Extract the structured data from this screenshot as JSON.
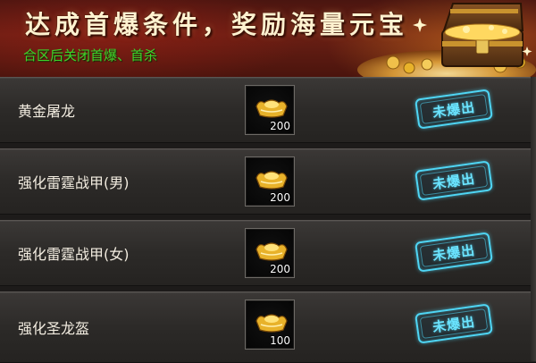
{
  "banner": {
    "title": "达成首爆条件，奖励海量元宝",
    "subtitle": "合区后关闭首爆、首杀"
  },
  "colors": {
    "title": "#fff2d0",
    "subtitle": "#3fd52a",
    "stamp": "#4fd6f5",
    "ingot": "#e8b22a"
  },
  "items": [
    {
      "name": "黄金屠龙",
      "reward_icon": "gold-ingot-icon",
      "reward_amount": "200",
      "status": "未爆出"
    },
    {
      "name": "强化雷霆战甲(男)",
      "reward_icon": "gold-ingot-icon",
      "reward_amount": "200",
      "status": "未爆出"
    },
    {
      "name": "强化雷霆战甲(女)",
      "reward_icon": "gold-ingot-icon",
      "reward_amount": "200",
      "status": "未爆出"
    },
    {
      "name": "强化圣龙盔",
      "reward_icon": "gold-ingot-icon",
      "reward_amount": "100",
      "status": "未爆出"
    }
  ]
}
